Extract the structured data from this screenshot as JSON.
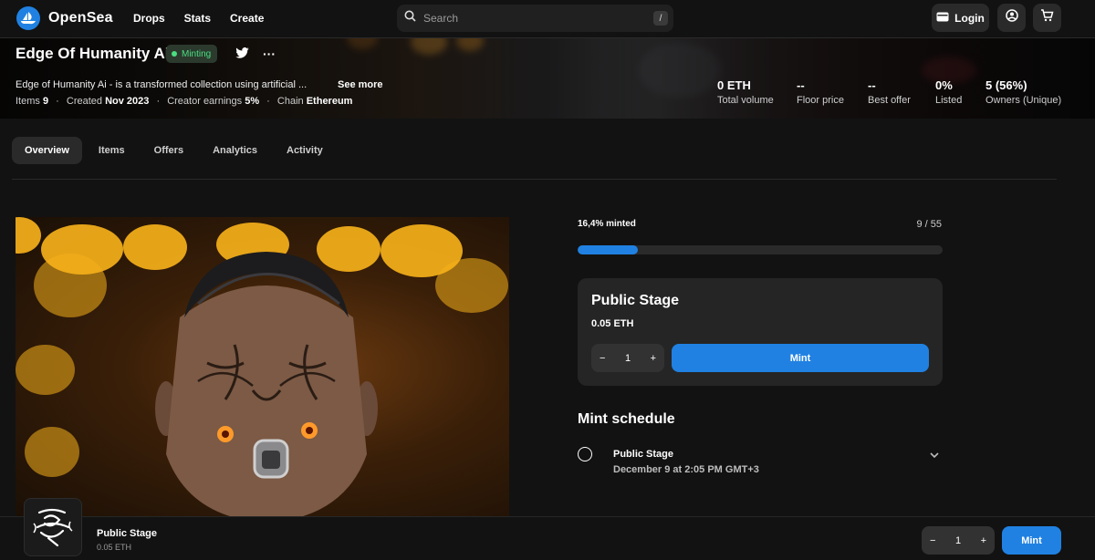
{
  "nav": {
    "logo_text": "OpenSea",
    "links": [
      "Drops",
      "Stats",
      "Create"
    ],
    "search_placeholder": "Search",
    "search_shortcut": "/",
    "login_label": "Login"
  },
  "collection": {
    "title": "Edge Of Humanity Ai",
    "status_badge": "Minting",
    "more_label": "···",
    "description": "Edge of Humanity Ai - is a transformed collection using artificial ...",
    "see_more": "See more",
    "meta": {
      "items_label": "Items",
      "items_value": "9",
      "created_label": "Created",
      "created_value": "Nov 2023",
      "earnings_label": "Creator earnings",
      "earnings_value": "5%",
      "chain_label": "Chain",
      "chain_value": "Ethereum",
      "separator": "·"
    },
    "stats": [
      {
        "value": "0 ETH",
        "label": "Total volume"
      },
      {
        "value": "--",
        "label": "Floor price"
      },
      {
        "value": "--",
        "label": "Best offer"
      },
      {
        "value": "0%",
        "label": "Listed"
      },
      {
        "value": "5 (56%)",
        "label": "Owners (Unique)"
      }
    ]
  },
  "tabs": [
    "Overview",
    "Items",
    "Offers",
    "Analytics",
    "Activity"
  ],
  "active_tab": "Overview",
  "mint": {
    "minted_label": "16,4% minted",
    "count_label": "9 / 55",
    "progress_fraction": 0.164,
    "stage_title": "Public Stage",
    "stage_price": "0.05 ETH",
    "quantity": "1",
    "minus": "−",
    "plus": "+",
    "mint_label": "Mint"
  },
  "schedule": {
    "title": "Mint schedule",
    "items": [
      {
        "name": "Public Stage",
        "date": "December 9 at 2:05 PM GMT+3"
      }
    ]
  },
  "bottom_bar": {
    "title": "Public Stage",
    "price": "0.05 ETH",
    "quantity": "1",
    "mint_label": "Mint"
  },
  "colors": {
    "accent": "#2081e2",
    "minting_green": "#4ade80",
    "background": "#121212"
  }
}
